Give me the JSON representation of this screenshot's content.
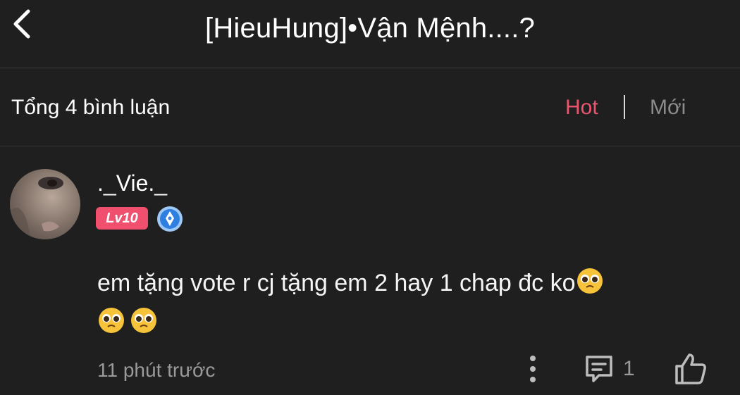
{
  "header": {
    "title": "[HieuHung]•Vận Mệnh....?"
  },
  "summary": {
    "count_label": "Tổng 4 bình luận",
    "sort_hot": "Hot",
    "sort_new": "Mới"
  },
  "comment": {
    "username": "._Vie._",
    "level": "Lv10",
    "text": "em tặng vote r cj tặng em 2 hay 1 chap đc ko",
    "time": "11 phút trước",
    "reply_count": "1"
  },
  "colors": {
    "accent": "#e9566e",
    "level_badge": "#f0506e",
    "background": "#1f1f1f"
  },
  "icons": [
    "back-icon",
    "verified-icon",
    "pleading-face-emoji",
    "more-icon",
    "reply-icon",
    "like-icon"
  ]
}
